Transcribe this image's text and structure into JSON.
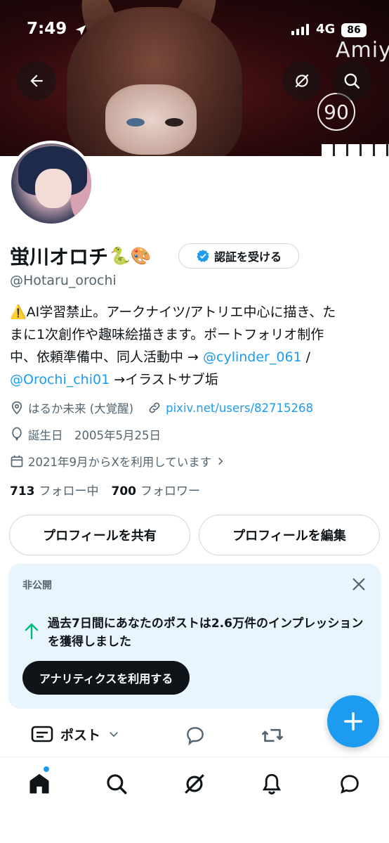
{
  "status_bar": {
    "time": "7:49",
    "network": "4G",
    "battery": "86"
  },
  "banner": {
    "deco_text": "Amiy",
    "deco_number": "90"
  },
  "profile": {
    "name": "蛍川オロチ",
    "name_emoji": "🐍🎨",
    "verify_label": "認証を受ける",
    "handle": "@Hotaru_orochi",
    "bio_line1": "⚠️AI学習禁止。アークナイツ/アトリエ中心に描き、た",
    "bio_line2": "まに1次創作や趣味絵描きます。ポートフォリオ制作",
    "bio_line3_pre": "中、依頼準備中、同人活動中 → ",
    "bio_link1": "@cylinder_061",
    "bio_line3_post": " /",
    "bio_link2": "@Orochi_chi01",
    "bio_line4_post": " →イラストサブ垢",
    "location": "はるか未来 (大覚醒)",
    "website": "pixiv.net/users/82715268",
    "birthday": "誕生日　2005年5月25日",
    "joined": "2021年9月からXを利用しています",
    "following_count": "713",
    "following_label": "フォロー中",
    "followers_count": "700",
    "followers_label": "フォロワー"
  },
  "actions": {
    "share_label": "プロフィールを共有",
    "edit_label": "プロフィールを編集"
  },
  "analytics_card": {
    "tag": "非公開",
    "message": "過去7日間にあなたのポストは2.6万件のインプレッションを獲得しました",
    "cta": "アナリティクスを利用する"
  },
  "tabs": {
    "posts_label": "ポスト"
  },
  "colors": {
    "accent": "#1d9bf0",
    "text": "#0f1419",
    "muted": "#536471"
  }
}
